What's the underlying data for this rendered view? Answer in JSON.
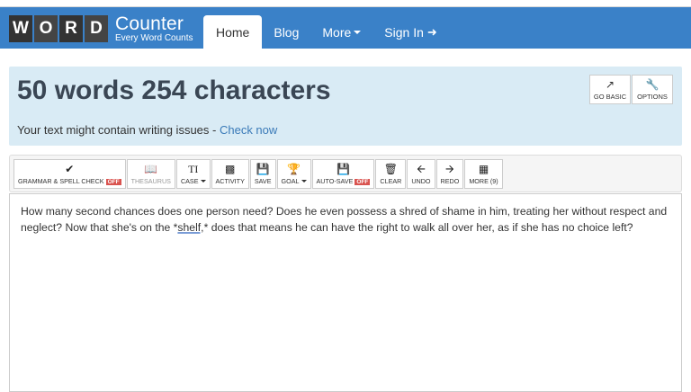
{
  "logo": {
    "letters": [
      "W",
      "O",
      "R",
      "D"
    ],
    "big": "Counter",
    "small": "Every Word Counts"
  },
  "nav": {
    "home": "Home",
    "blog": "Blog",
    "more": "More",
    "signin": "Sign In"
  },
  "stats": {
    "title": "50 words 254 characters",
    "sub_text": "Your text might contain writing issues - ",
    "sub_link": "Check now",
    "go_basic": "GO BASIC",
    "options": "OPTIONS"
  },
  "toolbar": {
    "grammar": "GRAMMAR & SPELL CHECK",
    "grammar_state": "OFF",
    "thesaurus": "THESAURUS",
    "case": "CASE",
    "activity": "ACTIVITY",
    "save": "SAVE",
    "goal": "GOAL",
    "autosave": "AUTO-SAVE",
    "autosave_state": "OFF",
    "clear": "CLEAR",
    "undo": "UNDO",
    "redo": "REDO",
    "more": "MORE (9)"
  },
  "editor": {
    "text_before": "How many second chances does one person need? Does he even possess a shred of shame in him, treating her without respect and neglect? Now that she's on the *",
    "text_marked": "shelf,",
    "text_after": "* does that means he can have the right to walk all over her, as if she has no choice left?"
  },
  "colors": {
    "navbar": "#3a81c8",
    "stats_bg": "#d9ebf5",
    "off_badge": "#d9534f",
    "link": "#3a7ab8"
  }
}
